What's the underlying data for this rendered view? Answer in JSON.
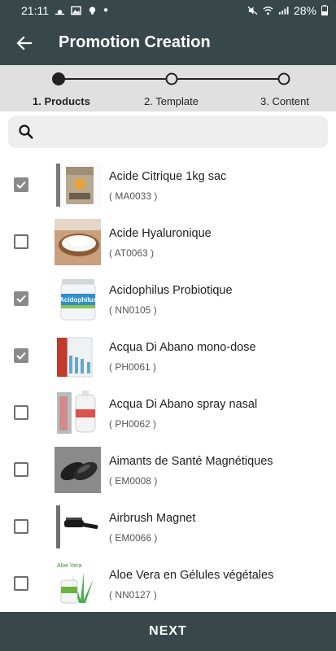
{
  "status_bar": {
    "time": "21:11",
    "battery": "28%"
  },
  "app_bar": {
    "title": "Promotion Creation"
  },
  "stepper": {
    "steps": [
      {
        "label": "1. Products",
        "active": true
      },
      {
        "label": "2. Template",
        "active": false
      },
      {
        "label": "3. Content",
        "active": false
      }
    ]
  },
  "search": {
    "value": "",
    "placeholder": ""
  },
  "products": [
    {
      "name": "Acide Citrique 1kg sac",
      "code": "( MA0033 )",
      "checked": true
    },
    {
      "name": "Acide Hyaluronique",
      "code": "( AT0063 )",
      "checked": false
    },
    {
      "name": "Acidophilus Probiotique",
      "code": "( NN0105 )",
      "checked": true
    },
    {
      "name": "Acqua Di Abano mono-dose",
      "code": "( PH0061 )",
      "checked": true
    },
    {
      "name": "Acqua Di Abano spray nasal",
      "code": "( PH0062 )",
      "checked": false
    },
    {
      "name": "Aimants de Santé Magnétiques",
      "code": "( EM0008 )",
      "checked": false
    },
    {
      "name": "Airbrush Magnet",
      "code": "( EM0066 )",
      "checked": false
    },
    {
      "name": "Aloe Vera en Gélules végétales",
      "code": "( NN0127 )",
      "checked": false
    }
  ],
  "thumbnail_labels": {
    "acidophilus": "Acidophilus",
    "aloe": "Aloe Vera"
  },
  "footer": {
    "next_label": "NEXT"
  },
  "colors": {
    "bar": "#37474a",
    "stepper_bg": "#e0e0e0",
    "checkbox_checked": "#8a8a8a"
  }
}
